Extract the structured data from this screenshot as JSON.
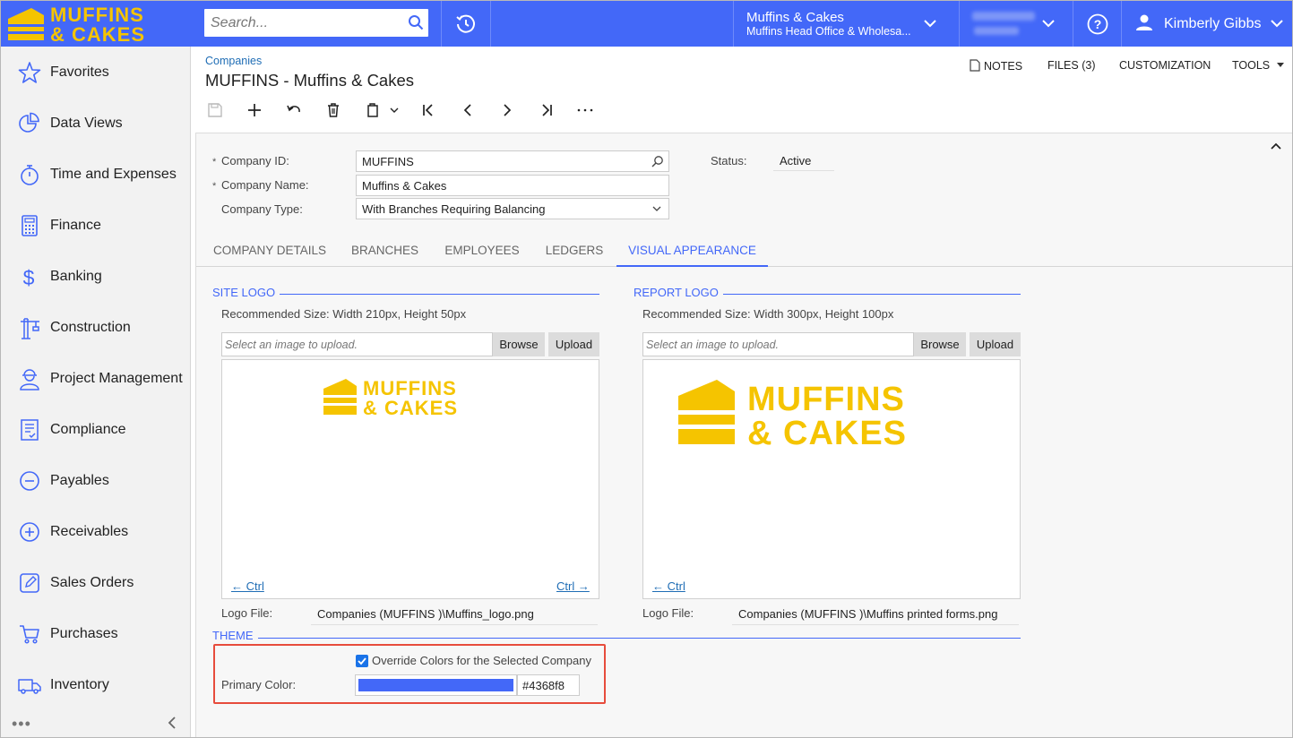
{
  "app": {
    "brand_line1": "MUFFINS",
    "brand_line2": "& CAKES",
    "brand_color": "#f5c400"
  },
  "topbar": {
    "search_placeholder": "Search...",
    "tenant_name": "Muffins & Cakes",
    "tenant_branch": "Muffins Head Office & Wholesa...",
    "user_name": "Kimberly Gibbs",
    "accent": "#4368f8"
  },
  "sidebar": {
    "items": [
      {
        "label": "Favorites",
        "icon": "star-icon"
      },
      {
        "label": "Data Views",
        "icon": "pie-chart-icon"
      },
      {
        "label": "Time and Expenses",
        "icon": "stopwatch-icon"
      },
      {
        "label": "Finance",
        "icon": "calculator-icon"
      },
      {
        "label": "Banking",
        "icon": "dollar-icon"
      },
      {
        "label": "Construction",
        "icon": "crane-icon"
      },
      {
        "label": "Project Management",
        "icon": "worker-icon"
      },
      {
        "label": "Compliance",
        "icon": "checklist-icon"
      },
      {
        "label": "Payables",
        "icon": "minus-circle-icon"
      },
      {
        "label": "Receivables",
        "icon": "plus-circle-icon"
      },
      {
        "label": "Sales Orders",
        "icon": "edit-icon"
      },
      {
        "label": "Purchases",
        "icon": "cart-icon"
      },
      {
        "label": "Inventory",
        "icon": "truck-icon"
      }
    ],
    "more": "•••"
  },
  "header": {
    "breadcrumb": "Companies",
    "title": "MUFFINS - Muffins & Cakes",
    "links": {
      "notes": "NOTES",
      "files": "FILES (3)",
      "customization": "CUSTOMIZATION",
      "tools": "TOOLS"
    }
  },
  "form": {
    "company_id_label": "Company ID:",
    "company_id": "MUFFINS",
    "company_name_label": "Company Name:",
    "company_name": "Muffins & Cakes",
    "company_type_label": "Company Type:",
    "company_type": "With Branches Requiring Balancing",
    "status_label": "Status:",
    "status": "Active",
    "required_mark": "*"
  },
  "tabs": [
    "COMPANY DETAILS",
    "BRANCHES",
    "EMPLOYEES",
    "LEDGERS",
    "VISUAL APPEARANCE"
  ],
  "site_logo": {
    "title": "SITE LOGO",
    "recommended": "Recommended Size: Width 210px, Height 50px",
    "placeholder": "Select an image to upload.",
    "browse": "Browse",
    "upload": "Upload",
    "prev": "← Ctrl",
    "next": "Ctrl →",
    "logo_file_label": "Logo File:",
    "logo_file": "Companies (MUFFINS    )\\Muffins_logo.png"
  },
  "report_logo": {
    "title": "REPORT LOGO",
    "recommended": "Recommended Size: Width 300px, Height 100px",
    "placeholder": "Select an image to upload.",
    "browse": "Browse",
    "upload": "Upload",
    "prev": "← Ctrl",
    "logo_file_label": "Logo File:",
    "logo_file": "Companies (MUFFINS    )\\Muffins printed forms.png"
  },
  "theme": {
    "title": "THEME",
    "override_label": "Override Colors for the Selected Company",
    "override_checked": true,
    "primary_color_label": "Primary Color:",
    "primary_color": "#4368f8"
  }
}
